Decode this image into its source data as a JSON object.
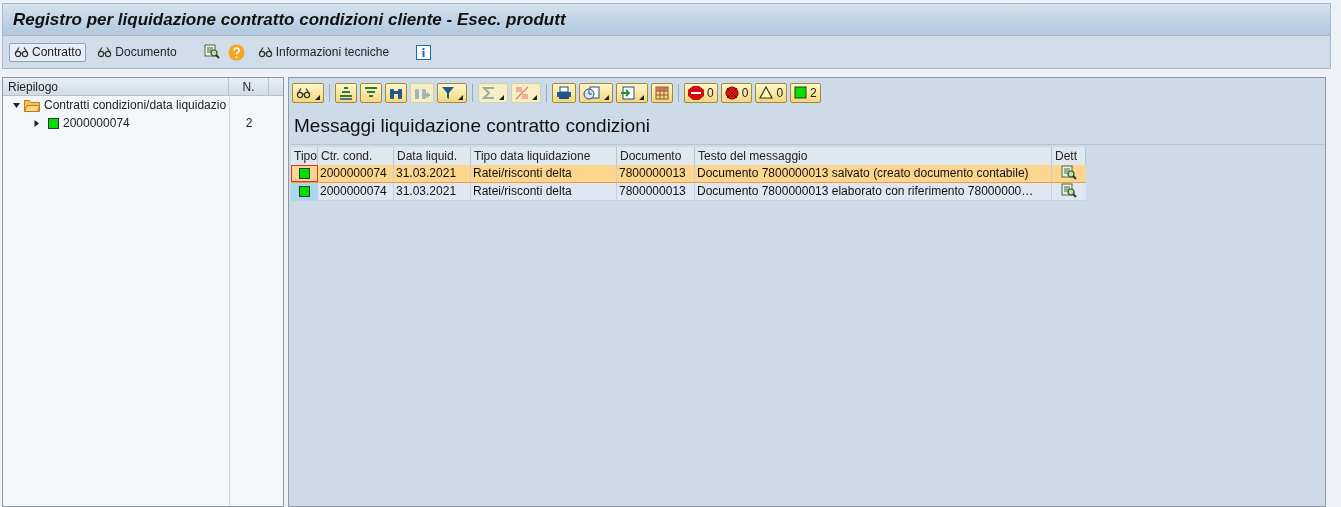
{
  "window": {
    "title": "Registro per liquidazione contratto condizioni cliente - Esec. produtt"
  },
  "toolbar": [
    {
      "kind": "glasses-button",
      "label": "Contratto",
      "pressed": true
    },
    {
      "kind": "glasses-button",
      "label": "Documento",
      "pressed": false
    },
    {
      "kind": "magnifier"
    },
    {
      "kind": "help"
    },
    {
      "kind": "glasses-button",
      "label": "Informazioni tecniche",
      "pressed": false
    },
    {
      "kind": "info"
    }
  ],
  "tree": {
    "columns": [
      "Riepilogo",
      "N."
    ],
    "items": [
      {
        "label": "Contratti condizioni/data liquidazio",
        "expanded": true,
        "children": [
          {
            "label": "2000000074",
            "count": "2",
            "expanded": false,
            "color": "#00e000"
          }
        ]
      }
    ]
  },
  "alv": {
    "toolbar": [
      {
        "kind": "glasses",
        "dropdown": true,
        "disabled": false
      },
      {
        "kind": "sort-asc",
        "dropdown": false,
        "disabled": false
      },
      {
        "kind": "sort-desc",
        "dropdown": false,
        "disabled": false
      },
      {
        "kind": "find",
        "dropdown": false,
        "disabled": false
      },
      {
        "kind": "find-next",
        "dropdown": false,
        "disabled": true
      },
      {
        "kind": "filter",
        "dropdown": true,
        "disabled": false
      },
      {
        "kind": "sum",
        "dropdown": true,
        "disabled": true
      },
      {
        "kind": "subtotal",
        "dropdown": true,
        "disabled": true
      },
      {
        "kind": "print",
        "dropdown": false,
        "disabled": false
      },
      {
        "kind": "views",
        "dropdown": true,
        "disabled": false
      },
      {
        "kind": "export",
        "dropdown": true,
        "disabled": false
      },
      {
        "kind": "layout",
        "dropdown": false,
        "disabled": false
      }
    ],
    "counters": [
      {
        "kind": "stop",
        "text": "0"
      },
      {
        "kind": "error",
        "text": "0"
      },
      {
        "kind": "warning",
        "text": "0"
      },
      {
        "kind": "success",
        "text": "2"
      }
    ],
    "title": "Messaggi liquidazione contratto condizioni",
    "status_column": "Tipo",
    "columns": [
      "Ctr. cond.",
      "Data liquid.",
      "Tipo data liquidazione",
      "Documento",
      "Testo del messaggio"
    ],
    "detail_column": "Dett",
    "rows": [
      {
        "selected": true,
        "color": "#00e000",
        "cells": [
          "2000000074",
          "31.03.2021",
          "Ratei/risconti delta",
          "7800000013",
          "Documento 7800000013 salvato (creato documento contabile)"
        ]
      },
      {
        "selected": false,
        "color": "#00e000",
        "cells": [
          "2000000074",
          "31.03.2021",
          "Ratei/risconti delta",
          "7800000013",
          "Documento 7800000013 elaborato con riferimento 78000000…"
        ]
      }
    ]
  }
}
